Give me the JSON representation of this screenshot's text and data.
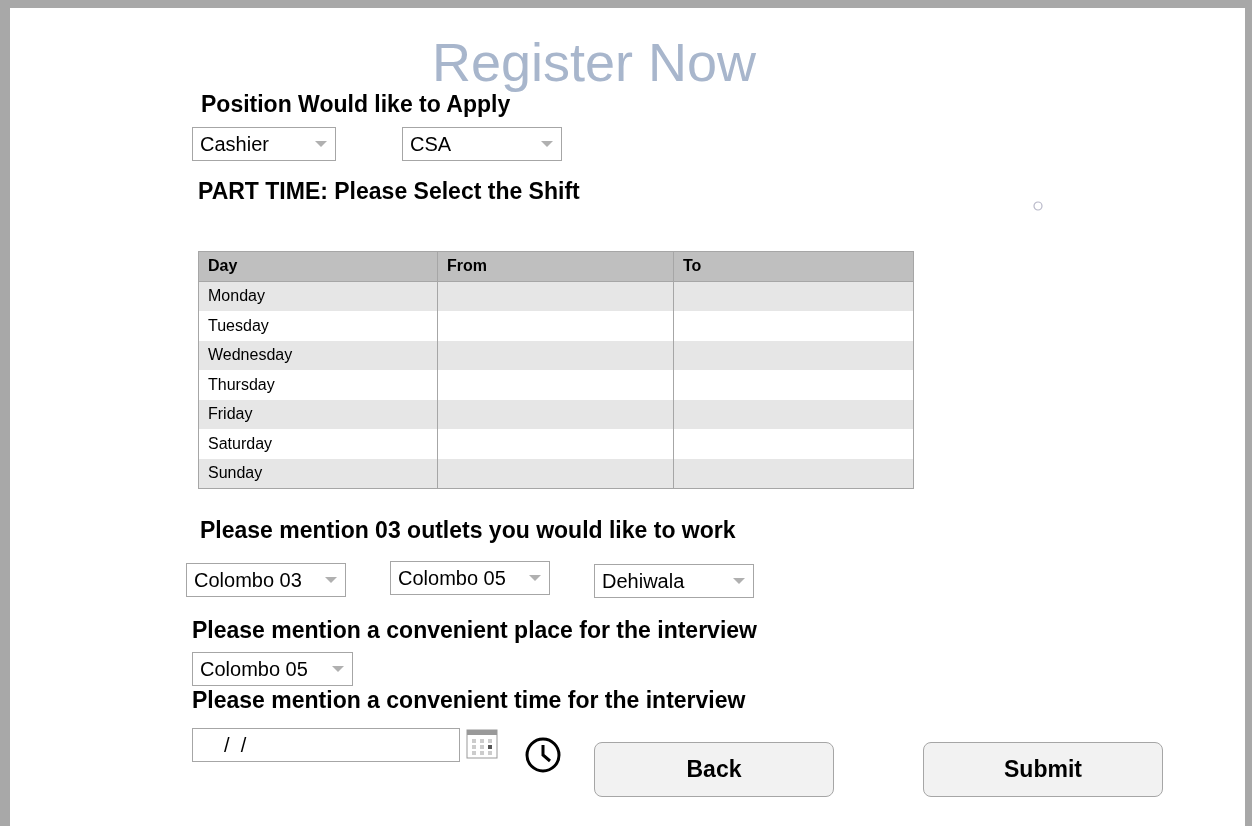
{
  "title": "Register Now",
  "position": {
    "heading": "Position Would like to Apply",
    "dropdowns": [
      "Cashier",
      "CSA"
    ]
  },
  "shift": {
    "heading": "PART TIME: Please Select the Shift",
    "columns": [
      "Day",
      "From",
      "To"
    ],
    "rows": [
      {
        "day": "Monday"
      },
      {
        "day": "Tuesday"
      },
      {
        "day": "Wednesday"
      },
      {
        "day": "Thursday"
      },
      {
        "day": "Friday"
      },
      {
        "day": "Saturday"
      },
      {
        "day": "Sunday"
      }
    ]
  },
  "outlets": {
    "heading": "Please mention 03 outlets you would like to work",
    "dropdowns": [
      "Colombo 03",
      "Colombo 05",
      "Dehiwala"
    ]
  },
  "interview_place": {
    "heading": "Please mention a convenient place for the interview",
    "dropdown": "Colombo 05"
  },
  "interview_time": {
    "heading": "Please mention a convenient time for the interview",
    "date_value": "  /  /"
  },
  "buttons": [
    {
      "label": "Back"
    },
    {
      "label": "Submit"
    }
  ]
}
